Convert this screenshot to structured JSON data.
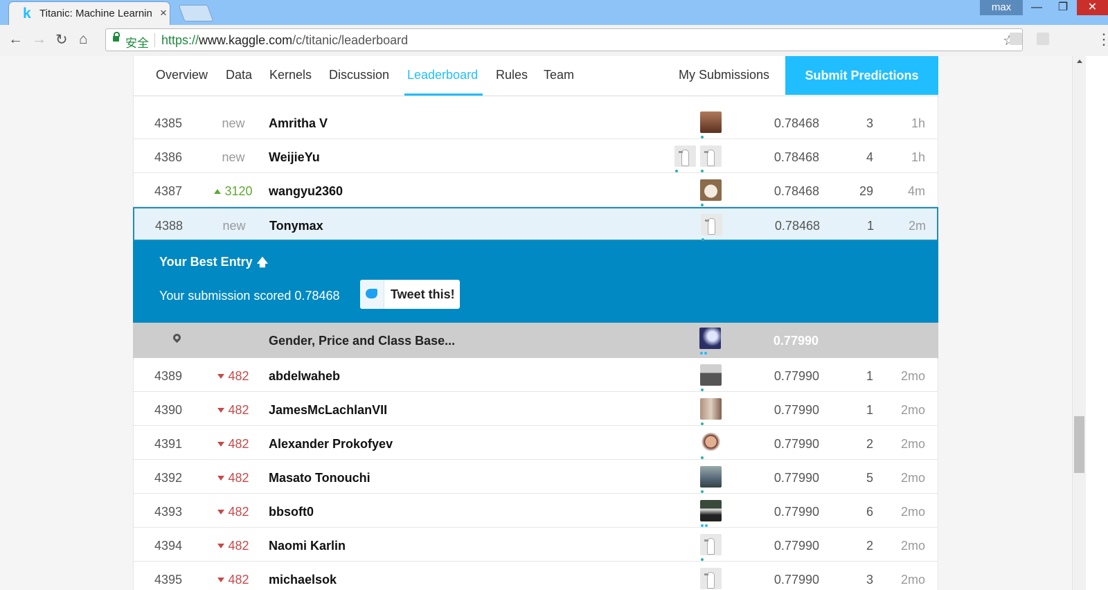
{
  "browser": {
    "tab_title": "Titanic: Machine Learnin",
    "tab_favicon": "k",
    "tab_close": "×",
    "user": "max",
    "secure_label": "安全",
    "url_scheme": "https://",
    "url_host": "www.kaggle.com",
    "url_path": "/c/titanic/leaderboard"
  },
  "nav": {
    "tabs": [
      {
        "label": "Overview"
      },
      {
        "label": "Data"
      },
      {
        "label": "Kernels"
      },
      {
        "label": "Discussion"
      },
      {
        "label": "Leaderboard"
      },
      {
        "label": "Rules"
      },
      {
        "label": "Team"
      }
    ],
    "my_submissions": "My Submissions",
    "submit": "Submit Predictions"
  },
  "rows_above": [
    {
      "rank": "4385",
      "change": "new",
      "name": "Amritha V",
      "score": "0.78468",
      "entries": "3",
      "last": "1h"
    },
    {
      "rank": "4386",
      "change": "new",
      "name": "WeijieYu",
      "score": "0.78468",
      "entries": "4",
      "last": "1h"
    },
    {
      "rank": "4387",
      "change": "3120",
      "name": "wangyu2360",
      "score": "0.78468",
      "entries": "29",
      "last": "4m"
    }
  ],
  "my_row": {
    "rank": "4388",
    "change": "new",
    "name": "Tonymax",
    "score": "0.78468",
    "entries": "1",
    "last": "2m"
  },
  "best_entry": {
    "title": "Your Best Entry",
    "text": "Your submission scored 0.78468",
    "tweet": "Tweet this!"
  },
  "benchmark": {
    "name": "Gender, Price and Class Base...",
    "score": "0.77990"
  },
  "rows_below": [
    {
      "rank": "4389",
      "change": "482",
      "name": "abdelwaheb",
      "score": "0.77990",
      "entries": "1",
      "last": "2mo"
    },
    {
      "rank": "4390",
      "change": "482",
      "name": "JamesMcLachlanVII",
      "score": "0.77990",
      "entries": "1",
      "last": "2mo"
    },
    {
      "rank": "4391",
      "change": "482",
      "name": "Alexander Prokofyev",
      "score": "0.77990",
      "entries": "2",
      "last": "2mo"
    },
    {
      "rank": "4392",
      "change": "482",
      "name": "Masato Tonouchi",
      "score": "0.77990",
      "entries": "5",
      "last": "2mo"
    },
    {
      "rank": "4393",
      "change": "482",
      "name": "bbsoft0",
      "score": "0.77990",
      "entries": "6",
      "last": "2mo"
    },
    {
      "rank": "4394",
      "change": "482",
      "name": "Naomi Karlin",
      "score": "0.77990",
      "entries": "2",
      "last": "2mo"
    },
    {
      "rank": "4395",
      "change": "482",
      "name": "michaelsok",
      "score": "0.77990",
      "entries": "3",
      "last": "2mo"
    }
  ],
  "colors": {
    "accent": "#20beff",
    "best_entry_bg": "#0089c2",
    "rank_up": "#5fa833",
    "rank_down": "#c64a4a"
  }
}
